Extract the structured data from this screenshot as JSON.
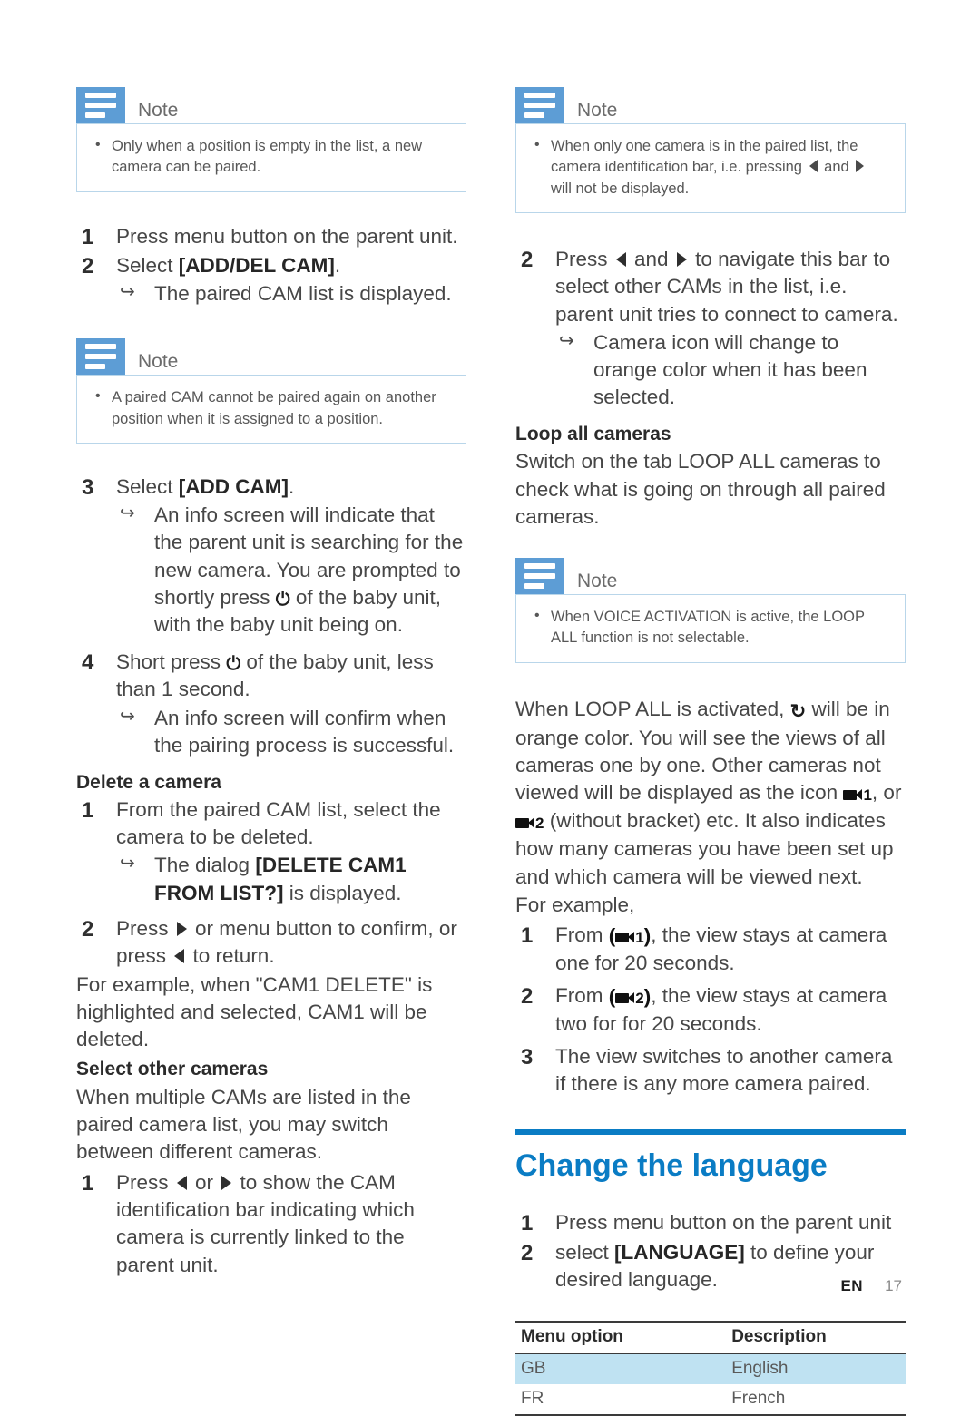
{
  "document": {
    "footer": {
      "lang_code": "EN",
      "page_number": "17"
    }
  },
  "left_column": {
    "note1": {
      "title": "Note",
      "bullets": [
        "Only when a position is empty in the list, a new camera can be paired."
      ]
    },
    "steps_a": [
      {
        "num": "1",
        "text": "Press menu button on the parent unit."
      },
      {
        "num": "2",
        "text_before": "Select ",
        "bold": "[ADD/DEL CAM]",
        "text_after": ".",
        "sub": "The paired CAM list is displayed."
      }
    ],
    "note2": {
      "title": "Note",
      "bullets": [
        "A paired CAM cannot be paired again on another position when it is assigned to a position."
      ]
    },
    "steps_b": [
      {
        "num": "3",
        "text_before": "Select ",
        "bold": "[ADD CAM]",
        "text_after": ".",
        "sub_1": "An info screen will indicate that the parent unit is searching for the new camera. You are prompted to shortly press ",
        "sub_2": " of the baby unit, with the baby unit being on."
      },
      {
        "num": "4",
        "text_1": "Short press ",
        "text_2": " of the baby unit, less than 1 second.",
        "sub": "An info screen will confirm when the pairing process is successful."
      }
    ],
    "delete_heading": "Delete a camera",
    "steps_delete": [
      {
        "num": "1",
        "text": "From the paired CAM list, select the camera to be deleted.",
        "sub_before": "The dialog ",
        "sub_bold": "[DELETE CAM1 FROM LIST?]",
        "sub_after": " is displayed."
      },
      {
        "num": "2",
        "text_1": "Press ",
        "text_2": " or menu button to confirm, or press ",
        "text_3": " to return."
      }
    ],
    "example_para": "For example, when \"CAM1 DELETE\" is highlighted and selected, CAM1 will be deleted.",
    "select_other_heading": "Select other cameras",
    "select_other_para": "When multiple CAMs are listed in the paired camera list, you may switch between different cameras.",
    "steps_select": [
      {
        "num": "1",
        "text_1": "Press ",
        "text_2": " or ",
        "text_3": " to show the CAM identification bar indicating which camera is currently linked to the parent unit."
      }
    ]
  },
  "right_column": {
    "note1": {
      "title": "Note",
      "bullet_1": "When only one camera is in the paired list, the camera identification bar, i.e. pressing ",
      "bullet_2": " and ",
      "bullet_3": " will not be displayed."
    },
    "step2": {
      "num": "2",
      "text_1": "Press ",
      "text_2": " and ",
      "text_3": " to navigate this bar to select other CAMs in the list, i.e. parent unit tries to connect to camera.",
      "sub": "Camera icon will change to orange color when it has been selected."
    },
    "loop_heading": "Loop all cameras",
    "loop_para": "Switch on the tab LOOP ALL cameras to check what is going on through all paired cameras.",
    "note2": {
      "title": "Note",
      "bullets": [
        "When VOICE ACTIVATION is active, the LOOP ALL function is not selectable."
      ]
    },
    "loop_body_1": "When LOOP ALL is activated, ",
    "loop_body_2": " will be in orange color. You will see the views of all cameras one by one. Other cameras not viewed will be displayed as the icon ",
    "loop_body_3": ", or ",
    "loop_body_4": " (without bracket) etc. It also indicates how many cameras you have been set up and which camera will be viewed next.",
    "for_example": "For example,",
    "example_steps": [
      {
        "num": "1",
        "text_1": "From ",
        "cam": "1",
        "text_2": ", the view stays at camera one for 20 seconds."
      },
      {
        "num": "2",
        "text_1": "From ",
        "cam": "2",
        "text_2": ", the view stays at camera two for for 20 seconds."
      },
      {
        "num": "3",
        "text_1": "The view switches to another camera if there is any more camera paired."
      }
    ],
    "language_section": {
      "title": "Change the language",
      "steps": [
        {
          "num": "1",
          "text": "Press menu button on the parent unit"
        },
        {
          "num": "2",
          "text_before": "select ",
          "bold": "[LANGUAGE]",
          "text_after": " to define your desired language."
        }
      ],
      "table": {
        "headers": [
          "Menu option",
          "Description"
        ],
        "rows": [
          {
            "option": "GB",
            "description": "English",
            "highlighted": true
          },
          {
            "option": "FR",
            "description": "French",
            "highlighted": false
          }
        ]
      }
    }
  },
  "icons": {
    "note_icon": "note-lines-icon",
    "power_glyph": "⏻",
    "loop_glyph": "↻",
    "camera_glyph": "video-camera-icon",
    "left_triangle": "◀",
    "right_triangle": "▶",
    "sub_arrow": "↪"
  },
  "colors": {
    "accent_blue": "#0a7cc4",
    "note_blue": "#5d9dd5",
    "note_border": "#b9d6ea",
    "table_highlight": "#bfe2f2"
  }
}
